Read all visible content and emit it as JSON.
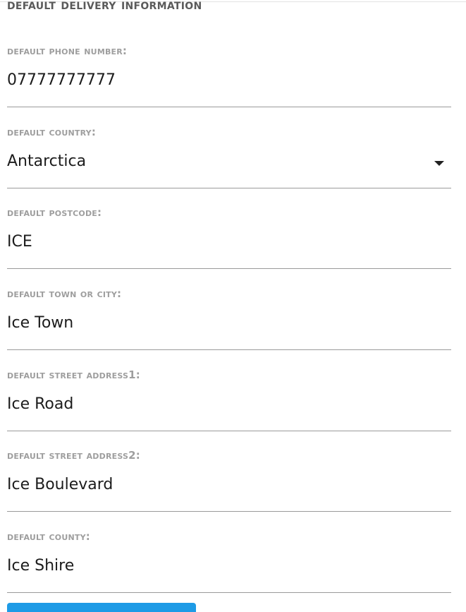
{
  "section": {
    "title": "Default Delivery Information"
  },
  "fields": [
    {
      "label": "Default Phone Number:",
      "value": "07777777777"
    },
    {
      "label": "Default Country:",
      "value": "Antarctica",
      "icon": "dropdown-arrow-icon"
    },
    {
      "label": "Default Postcode:",
      "value": "ICE"
    },
    {
      "label": "Default Town or City:",
      "value": "Ice Town"
    },
    {
      "label": "Default Street Address1:",
      "value": "Ice Road"
    },
    {
      "label": "Default Street Address2:",
      "value": "Ice Boulevard"
    },
    {
      "label": "Default County:",
      "value": "Ice Shire"
    }
  ],
  "colors": {
    "title": "#5a5a5a",
    "label": "#9e9e9e",
    "value": "#1c1c1c",
    "underline": "#9a9a9a",
    "button": "#1e9be6"
  }
}
